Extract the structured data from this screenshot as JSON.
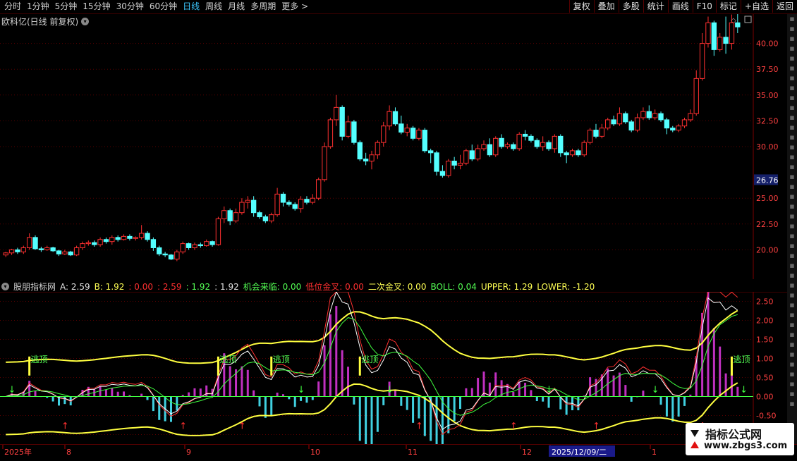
{
  "toolbar": {
    "periods": [
      "分时",
      "1分钟",
      "5分钟",
      "15分钟",
      "30分钟",
      "60分钟",
      "日线",
      "周线",
      "月线",
      "多周期",
      "更多 >"
    ],
    "active_period": "日线",
    "actions": [
      "复权",
      "叠加",
      "多股",
      "统计",
      "画线",
      "F10",
      "标记",
      "+自选",
      "返回"
    ]
  },
  "main_panel": {
    "title": "欧科亿(日线 前复权)",
    "price_ticks": [
      "40.00",
      "37.50",
      "35.00",
      "32.50",
      "30.00",
      "25.00",
      "22.50",
      "20.00"
    ],
    "price_range": [
      17.5,
      42.5
    ],
    "last_price": "26.76",
    "up_color": "#ff3030",
    "down_color": "#54ffff"
  },
  "indicator_panel": {
    "name": "股朋指标网",
    "values": [
      {
        "text": "A: 2.59",
        "color": "#e0e0e0"
      },
      {
        "text": "B: 1.92",
        "color": "#ffff54"
      },
      {
        "text": ": 0.00",
        "color": "#ff3030"
      },
      {
        "text": ": 2.59",
        "color": "#ff3030"
      },
      {
        "text": ": 1.92",
        "color": "#54ff54"
      },
      {
        "text": ": 1.92",
        "color": "#e0e0e0"
      },
      {
        "text": "机会来临: 0.00",
        "color": "#54ff54"
      },
      {
        "text": "低位金叉: 0.00",
        "color": "#ff3030"
      },
      {
        "text": "二次金叉: 0.00",
        "color": "#ffff54"
      },
      {
        "text": "BOLL: 0.04",
        "color": "#54ff54"
      },
      {
        "text": "UPPER: 1.29",
        "color": "#ffff54"
      },
      {
        "text": "LOWER: -1.20",
        "color": "#ffff54"
      }
    ],
    "ticks": [
      "2.50",
      "2.00",
      "1.50",
      "1.00",
      "0.50",
      "0.00",
      "-0.50",
      "-1.00"
    ],
    "range": [
      -1.25,
      2.75
    ],
    "signal_label": "逃顶"
  },
  "chart_data": {
    "type": "candlestick",
    "x_labels": [
      "2025年",
      "8",
      "9",
      "10",
      "11",
      "12",
      "2025/12/09/二",
      "1"
    ],
    "candles": [
      [
        19.5,
        19.7,
        19.3,
        19.8
      ],
      [
        19.7,
        20.0,
        19.5,
        20.1
      ],
      [
        20.0,
        19.8,
        19.6,
        20.2
      ],
      [
        19.8,
        20.2,
        19.6,
        20.4
      ],
      [
        20.2,
        21.2,
        20.0,
        21.6
      ],
      [
        21.2,
        20.1,
        20.0,
        21.4
      ],
      [
        20.1,
        20.0,
        19.8,
        20.3
      ],
      [
        20.0,
        20.2,
        19.9,
        20.4
      ],
      [
        20.2,
        19.9,
        19.8,
        20.3
      ],
      [
        19.9,
        19.6,
        19.4,
        20.0
      ],
      [
        19.6,
        19.8,
        19.5,
        20.0
      ],
      [
        19.8,
        19.5,
        19.4,
        19.9
      ],
      [
        19.5,
        20.2,
        19.4,
        20.4
      ],
      [
        20.2,
        20.6,
        20.0,
        20.8
      ],
      [
        20.6,
        20.7,
        20.4,
        20.9
      ],
      [
        20.7,
        20.5,
        20.3,
        20.9
      ],
      [
        20.5,
        21.0,
        20.3,
        21.2
      ],
      [
        21.0,
        20.8,
        20.6,
        21.2
      ],
      [
        20.8,
        21.2,
        20.5,
        21.4
      ],
      [
        21.2,
        21.0,
        20.8,
        21.4
      ],
      [
        21.0,
        21.3,
        20.9,
        21.5
      ],
      [
        21.3,
        21.1,
        20.9,
        21.5
      ],
      [
        21.1,
        21.2,
        20.9,
        21.3
      ],
      [
        21.2,
        21.6,
        21.0,
        22.4
      ],
      [
        21.6,
        21.0,
        20.8,
        21.8
      ],
      [
        21.0,
        20.2,
        19.9,
        21.2
      ],
      [
        20.2,
        19.6,
        19.4,
        20.4
      ],
      [
        19.6,
        19.5,
        19.3,
        19.8
      ],
      [
        19.5,
        19.1,
        19.0,
        19.6
      ],
      [
        19.1,
        19.8,
        18.9,
        20.0
      ],
      [
        19.8,
        20.6,
        19.6,
        20.8
      ],
      [
        20.6,
        20.2,
        20.0,
        20.7
      ],
      [
        20.2,
        20.5,
        20.0,
        20.7
      ],
      [
        20.5,
        20.4,
        20.2,
        20.7
      ],
      [
        20.4,
        20.8,
        20.3,
        21.0
      ],
      [
        20.8,
        20.5,
        20.3,
        20.9
      ],
      [
        20.5,
        23.0,
        20.4,
        23.2
      ],
      [
        23.0,
        23.8,
        22.6,
        24.2
      ],
      [
        23.8,
        22.8,
        22.4,
        24.0
      ],
      [
        22.8,
        23.6,
        22.6,
        24.0
      ],
      [
        23.6,
        24.6,
        23.4,
        25.0
      ],
      [
        24.6,
        24.8,
        24.0,
        25.2
      ],
      [
        24.8,
        23.6,
        23.2,
        25.2
      ],
      [
        23.6,
        23.2,
        23.0,
        23.8
      ],
      [
        23.2,
        22.8,
        22.6,
        23.4
      ],
      [
        22.8,
        23.4,
        22.6,
        23.6
      ],
      [
        23.4,
        25.4,
        23.2,
        26.0
      ],
      [
        25.4,
        24.6,
        24.2,
        25.6
      ],
      [
        24.6,
        24.4,
        24.2,
        24.8
      ],
      [
        24.4,
        24.0,
        23.8,
        24.6
      ],
      [
        24.0,
        24.9,
        23.6,
        25.2
      ],
      [
        24.9,
        24.6,
        24.4,
        25.2
      ],
      [
        24.6,
        25.0,
        24.4,
        25.4
      ],
      [
        25.0,
        26.8,
        24.8,
        27.0
      ],
      [
        26.8,
        30.0,
        26.6,
        30.4
      ],
      [
        30.0,
        32.6,
        29.8,
        32.8
      ],
      [
        32.6,
        33.8,
        32.0,
        35.0
      ],
      [
        33.8,
        31.0,
        30.6,
        34.0
      ],
      [
        31.0,
        32.4,
        30.8,
        33.0
      ],
      [
        32.4,
        30.4,
        30.2,
        32.6
      ],
      [
        30.4,
        28.8,
        28.6,
        30.6
      ],
      [
        28.8,
        28.6,
        28.2,
        29.4
      ],
      [
        28.6,
        29.2,
        27.8,
        29.6
      ],
      [
        29.2,
        30.4,
        28.8,
        30.6
      ],
      [
        30.4,
        32.0,
        30.0,
        32.4
      ],
      [
        32.0,
        33.4,
        31.6,
        34.0
      ],
      [
        33.4,
        32.2,
        32.0,
        33.8
      ],
      [
        32.2,
        31.4,
        31.2,
        33.0
      ],
      [
        31.4,
        31.8,
        31.0,
        32.2
      ],
      [
        31.8,
        30.8,
        30.6,
        32.0
      ],
      [
        30.8,
        31.6,
        30.6,
        31.8
      ],
      [
        31.6,
        29.6,
        29.4,
        31.8
      ],
      [
        29.6,
        29.4,
        28.4,
        29.8
      ],
      [
        29.4,
        27.6,
        27.2,
        29.6
      ],
      [
        27.6,
        27.2,
        27.0,
        28.2
      ],
      [
        27.2,
        28.6,
        27.0,
        28.8
      ],
      [
        28.6,
        28.2,
        27.8,
        29.0
      ],
      [
        28.2,
        28.4,
        27.8,
        29.2
      ],
      [
        28.4,
        29.6,
        28.2,
        29.8
      ],
      [
        29.6,
        28.8,
        28.6,
        30.2
      ],
      [
        28.8,
        29.8,
        28.6,
        30.2
      ],
      [
        29.8,
        30.2,
        29.6,
        30.6
      ],
      [
        30.2,
        29.2,
        29.0,
        30.8
      ],
      [
        29.2,
        30.8,
        29.0,
        31.0
      ],
      [
        30.8,
        30.0,
        29.8,
        31.2
      ],
      [
        30.0,
        30.2,
        29.8,
        30.4
      ],
      [
        30.2,
        29.8,
        29.6,
        30.4
      ],
      [
        29.8,
        31.2,
        29.6,
        31.4
      ],
      [
        31.2,
        31.0,
        30.6,
        31.6
      ],
      [
        31.0,
        30.6,
        30.4,
        31.2
      ],
      [
        30.6,
        30.0,
        29.8,
        30.8
      ],
      [
        30.0,
        30.4,
        29.6,
        31.0
      ],
      [
        30.4,
        29.8,
        29.6,
        30.6
      ],
      [
        29.8,
        31.0,
        29.4,
        31.2
      ],
      [
        31.0,
        29.4,
        29.0,
        31.2
      ],
      [
        29.4,
        29.2,
        28.4,
        29.6
      ],
      [
        29.2,
        29.6,
        29.0,
        29.8
      ],
      [
        29.6,
        29.2,
        29.0,
        29.8
      ],
      [
        29.2,
        30.4,
        29.0,
        30.6
      ],
      [
        30.4,
        31.6,
        30.2,
        31.8
      ],
      [
        31.6,
        31.0,
        30.8,
        32.2
      ],
      [
        31.0,
        31.8,
        30.8,
        32.2
      ],
      [
        31.8,
        32.6,
        31.6,
        32.8
      ],
      [
        32.6,
        32.2,
        32.0,
        33.0
      ],
      [
        32.2,
        33.2,
        32.0,
        33.8
      ],
      [
        33.2,
        32.4,
        32.2,
        33.4
      ],
      [
        32.4,
        31.6,
        31.4,
        32.6
      ],
      [
        31.6,
        32.8,
        31.4,
        33.2
      ],
      [
        32.8,
        33.4,
        32.6,
        33.8
      ],
      [
        33.4,
        32.8,
        32.6,
        34.0
      ],
      [
        32.8,
        33.2,
        32.6,
        33.6
      ],
      [
        33.2,
        32.6,
        32.4,
        33.4
      ],
      [
        32.6,
        31.8,
        31.2,
        32.8
      ],
      [
        31.8,
        31.6,
        31.4,
        32.0
      ],
      [
        31.6,
        32.0,
        31.4,
        32.2
      ],
      [
        32.0,
        32.6,
        31.8,
        32.8
      ],
      [
        32.6,
        33.2,
        32.4,
        33.6
      ],
      [
        33.2,
        36.6,
        33.0,
        37.4
      ],
      [
        36.6,
        40.0,
        36.4,
        41.0
      ],
      [
        40.0,
        42.0,
        39.6,
        42.6
      ],
      [
        42.0,
        39.4,
        38.8,
        42.2
      ],
      [
        39.4,
        40.6,
        39.2,
        41.0
      ],
      [
        40.6,
        40.0,
        39.0,
        42.6
      ],
      [
        40.0,
        42.0,
        39.4,
        42.8
      ],
      [
        42.0,
        41.6,
        41.0,
        43.0
      ]
    ]
  }
}
